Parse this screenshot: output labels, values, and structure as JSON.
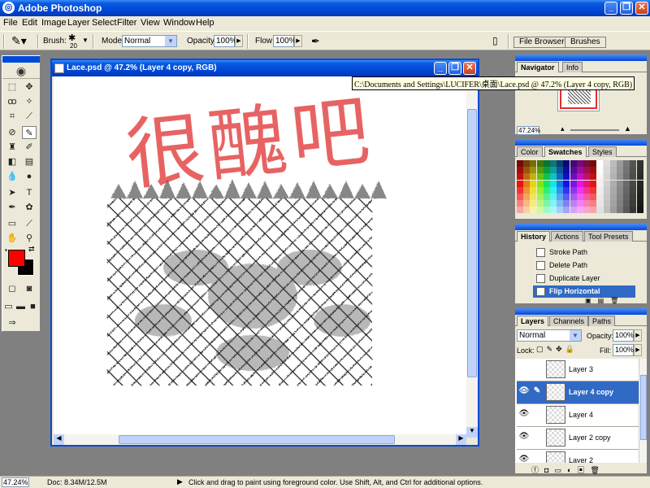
{
  "app": {
    "title": "Adobe Photoshop"
  },
  "menubar": [
    "File",
    "Edit",
    "Image",
    "Layer",
    "Select",
    "Filter",
    "View",
    "Window",
    "Help"
  ],
  "options": {
    "brush_label": "Brush:",
    "brush_size": "20",
    "mode_label": "Mode:",
    "mode_value": "Normal",
    "opacity_label": "Opacity:",
    "opacity_value": "100%",
    "flow_label": "Flow:",
    "flow_value": "100%",
    "well_tabs": [
      "File Browser",
      "Brushes"
    ]
  },
  "document": {
    "title": "Lace.psd @ 47.2% (Layer 4 copy, RGB)",
    "tooltip": "C:\\Documents and Settings\\LUCIFER\\桌面\\Lace.psd @ 47.2% (Layer 4 copy, RGB)",
    "canvas_text": "很醜吧",
    "canvas_text_color": "#e03030"
  },
  "navigator": {
    "tabs": [
      "Navigator",
      "Info"
    ],
    "zoom": "47.24%"
  },
  "swatches_panel": {
    "tabs": [
      "Color",
      "Swatches",
      "Styles"
    ]
  },
  "history": {
    "tabs": [
      "History",
      "Actions",
      "Tool Presets"
    ],
    "items": [
      "Stroke Path",
      "Delete Path",
      "Duplicate Layer",
      "Flip Horizontal"
    ]
  },
  "layers": {
    "tabs": [
      "Layers",
      "Channels",
      "Paths"
    ],
    "blend_mode": "Normal",
    "opacity_label": "Opacity:",
    "opacity_value": "100%",
    "lock_label": "Lock:",
    "fill_label": "Fill:",
    "fill_value": "100%",
    "items": [
      "Layer 3",
      "Layer 4 copy",
      "Layer 4",
      "Layer 2 copy",
      "Layer 2"
    ]
  },
  "colors": {
    "foreground": "#ff0000",
    "background": "#000000",
    "accent": "#0049d8",
    "selection": "#316ac5"
  },
  "status": {
    "zoom": "47.24%",
    "doc": "Doc: 8.34M/12.5M",
    "hint": "Click and drag to paint using foreground color.  Use Shift, Alt, and Ctrl for additional options."
  }
}
